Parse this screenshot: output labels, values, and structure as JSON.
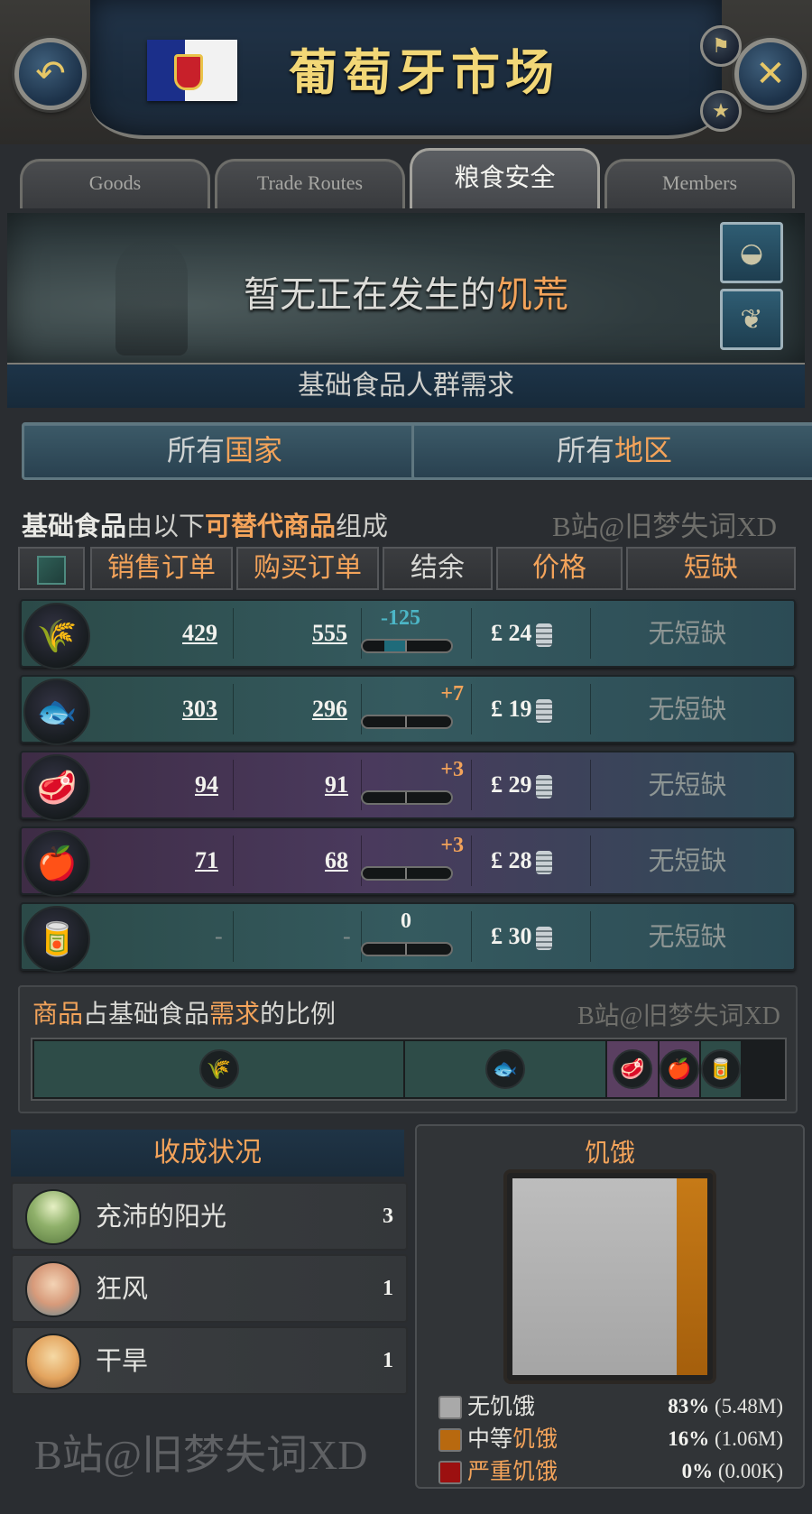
{
  "header": {
    "title": "葡萄牙市场",
    "back_icon": "back-arrow-icon",
    "close_icon": "close-icon",
    "pin_icon": "signpost-icon",
    "favorite_icon": "star-icon"
  },
  "tabs": [
    {
      "label": "Goods",
      "active": false
    },
    {
      "label": "Trade Routes",
      "active": false
    },
    {
      "label": "粮食安全",
      "active": true
    },
    {
      "label": "Members",
      "active": false
    }
  ],
  "famine": {
    "text_prefix": "暂无正在发生的",
    "text_highlight": "饥荒",
    "button1_icon": "bowl-icon",
    "button2_icon": "grain-leaf-icon"
  },
  "section_title": "基础食品人群需求",
  "scope": {
    "countries_prefix": "所有",
    "countries_highlight": "国家",
    "regions_prefix": "所有",
    "regions_highlight": "地区"
  },
  "subtitle": {
    "part1": "基础食品",
    "part2": "由以下",
    "part3": "可替代商品",
    "part4": "组成"
  },
  "watermark1": "B站@旧梦失词XD",
  "watermark2": "B站@旧梦失词XD",
  "watermark3": "B站@旧梦失词XD",
  "table": {
    "headers": [
      "销售订单",
      "购买订单",
      "结余",
      "价格",
      "短缺"
    ],
    "rows": [
      {
        "icon": "wheat-icon",
        "sell": "429",
        "buy": "555",
        "balance": "-125",
        "balance_fill": -0.5,
        "price": "£ 24",
        "shortage": "无短缺"
      },
      {
        "icon": "fish-icon",
        "sell": "303",
        "buy": "296",
        "balance": "+7",
        "balance_fill": 0.0,
        "price": "£ 19",
        "shortage": "无短缺"
      },
      {
        "icon": "meat-icon",
        "sell": "94",
        "buy": "91",
        "balance": "+3",
        "balance_fill": 0.0,
        "price": "£ 29",
        "shortage": "无短缺"
      },
      {
        "icon": "fruit-icon",
        "sell": "71",
        "buy": "68",
        "balance": "+3",
        "balance_fill": 0.0,
        "price": "£ 28",
        "shortage": "无短缺"
      },
      {
        "icon": "groceries-icon",
        "sell": "-",
        "buy": "-",
        "balance": "0",
        "balance_fill": 0.0,
        "price": "£ 30",
        "shortage": "无短缺"
      }
    ]
  },
  "share": {
    "title_p1": "商品",
    "title_p2": "占基础食品",
    "title_p3": "需求",
    "title_p4": "的比例",
    "segments": [
      {
        "icon": "wheat-icon",
        "share": 0.495,
        "color": "#2e4c48"
      },
      {
        "icon": "fish-icon",
        "share": 0.27,
        "color": "#2e4c48"
      },
      {
        "icon": "meat-icon",
        "share": 0.07,
        "color": "#5a3f61"
      },
      {
        "icon": "fruit-icon",
        "share": 0.055,
        "color": "#5a3f61"
      },
      {
        "icon": "groceries-icon",
        "share": 0.055,
        "color": "#2e4c48"
      }
    ]
  },
  "harvest": {
    "title": "收成状况",
    "items": [
      {
        "icon": "sunshine-icon",
        "label": "充沛的阳光",
        "value": "3"
      },
      {
        "icon": "wind-icon",
        "label": "狂风",
        "value": "1"
      },
      {
        "icon": "drought-icon",
        "label": "干旱",
        "value": "1"
      }
    ]
  },
  "hunger": {
    "title": "饥饿",
    "none_share": 0.83,
    "moderate_share": 0.16,
    "severe_share": 0.0,
    "legend": [
      {
        "label_p1": "无",
        "label_hl": "饥饿",
        "label_p2": "",
        "pct": "83%",
        "amount": "(5.48M)",
        "color": "#a9a9a9"
      },
      {
        "label_p1": "中等",
        "label_hl": "饥饿",
        "label_p2": "",
        "pct": "16%",
        "amount": "(1.06M)",
        "color": "#b8690f"
      },
      {
        "label_p1": "",
        "label_hl": "严重饥饿",
        "label_p2": "",
        "pct": "0%",
        "amount": "(0.00K)",
        "color": "#9c1010"
      }
    ]
  }
}
